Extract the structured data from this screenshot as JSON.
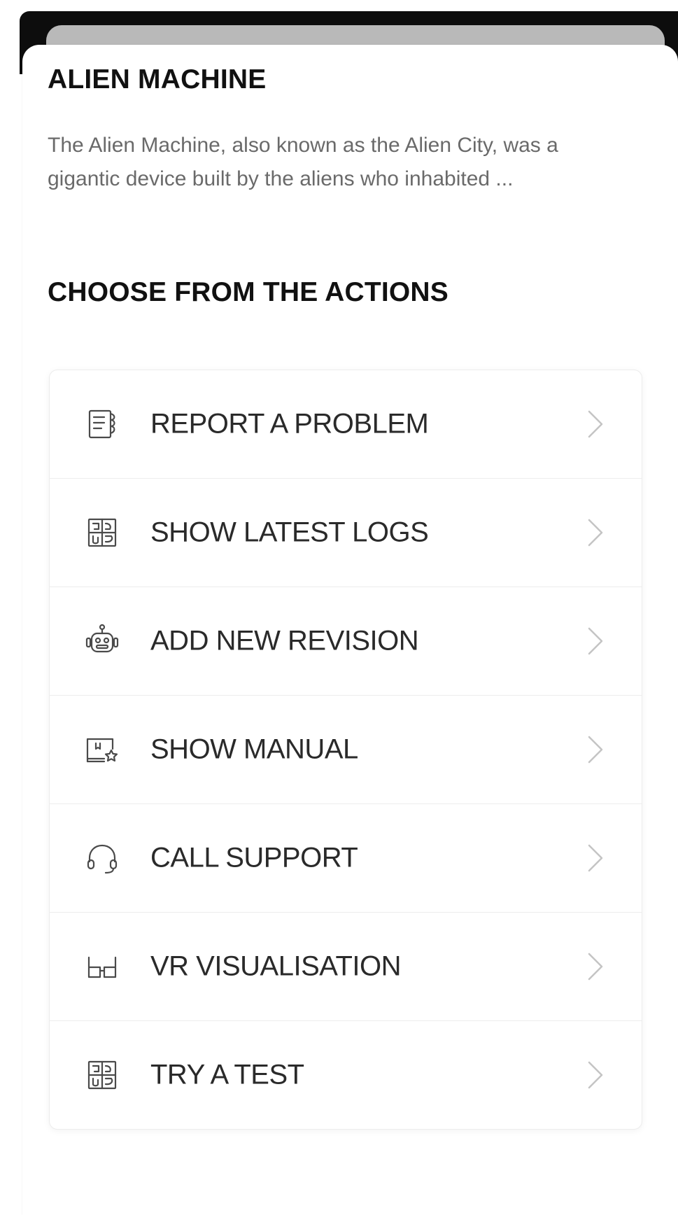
{
  "device": {
    "title": "ALIEN MACHINE",
    "description": "The Alien Machine, also known as the Alien City, was a gigantic device built by the aliens who inhabited ..."
  },
  "actions_section": {
    "heading": "CHOOSE FROM THE ACTIONS",
    "items": [
      {
        "label": "REPORT A PROBLEM",
        "icon": "report-icon"
      },
      {
        "label": "SHOW LATEST LOGS",
        "icon": "logs-icon"
      },
      {
        "label": "ADD NEW REVISION",
        "icon": "robot-icon"
      },
      {
        "label": "SHOW MANUAL",
        "icon": "manual-icon"
      },
      {
        "label": "CALL SUPPORT",
        "icon": "headset-icon"
      },
      {
        "label": "VR VISUALISATION",
        "icon": "vr-glasses-icon"
      },
      {
        "label": "TRY A TEST",
        "icon": "test-icon"
      }
    ]
  },
  "colors": {
    "title_text": "#111111",
    "body_text": "#6a6a6a",
    "label_text": "#2a2a2a",
    "icon_stroke": "#4a4a4a",
    "chevron": "#c4c4c4",
    "top_bar": "#0d0d0d",
    "sheet_back": "#b9b9b9"
  }
}
